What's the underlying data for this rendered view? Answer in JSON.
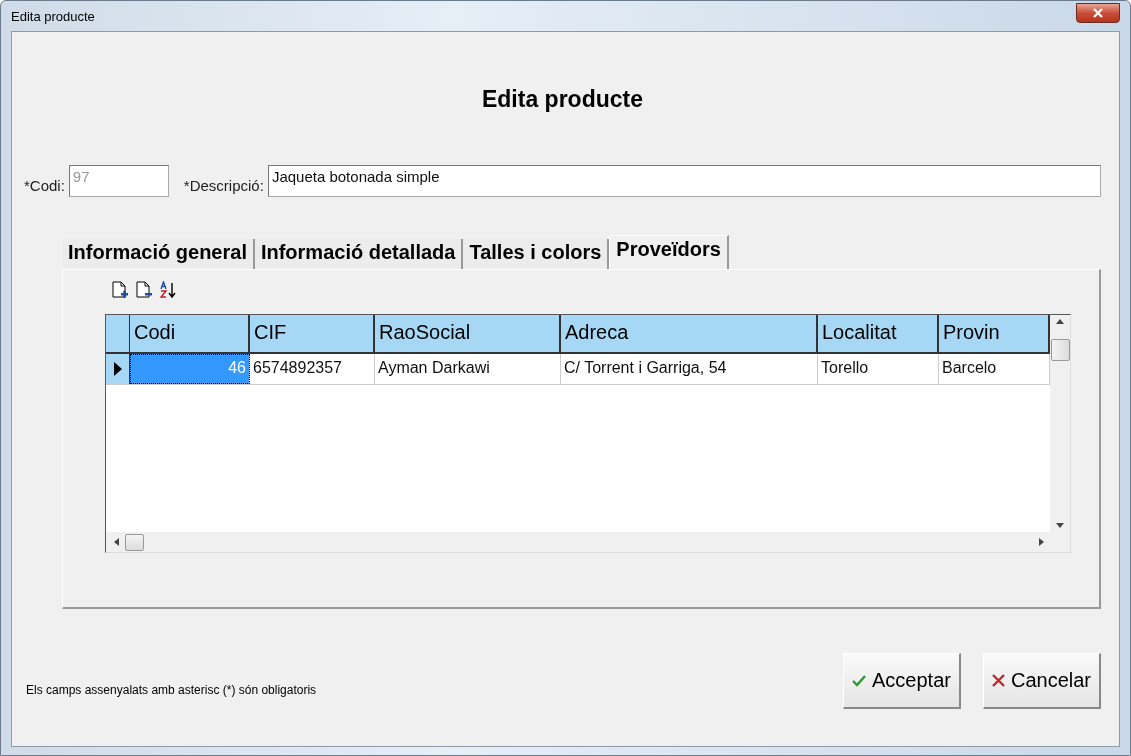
{
  "window": {
    "title": "Edita producte"
  },
  "heading": "Edita producte",
  "fields": [
    {
      "label": "*Codi:",
      "value": "97",
      "disabled": true
    },
    {
      "label": "*Descripció:",
      "value": "Jaqueta botonada simple",
      "disabled": false
    }
  ],
  "tabs": [
    {
      "label": "Informació general",
      "selected": false
    },
    {
      "label": "Informació detallada",
      "selected": false
    },
    {
      "label": "Talles i colors",
      "selected": false
    },
    {
      "label": "Proveïdors",
      "selected": true
    }
  ],
  "table": {
    "columns": [
      "Codi",
      "CIF",
      "RaoSocial",
      "Adreca",
      "Localitat",
      "Provin"
    ],
    "rows": [
      {
        "selected": true,
        "cells": [
          "46",
          "6574892357",
          "Ayman Darkawi",
          "C/ Torrent i Garriga, 54",
          "Torello",
          "Barcelo"
        ]
      }
    ]
  },
  "note": "Els camps assenyalats amb asterisc (*) són obligatoris",
  "buttons": [
    {
      "kind": "accept",
      "label": "Acceptar"
    },
    {
      "kind": "cancel",
      "label": "Cancelar"
    }
  ]
}
